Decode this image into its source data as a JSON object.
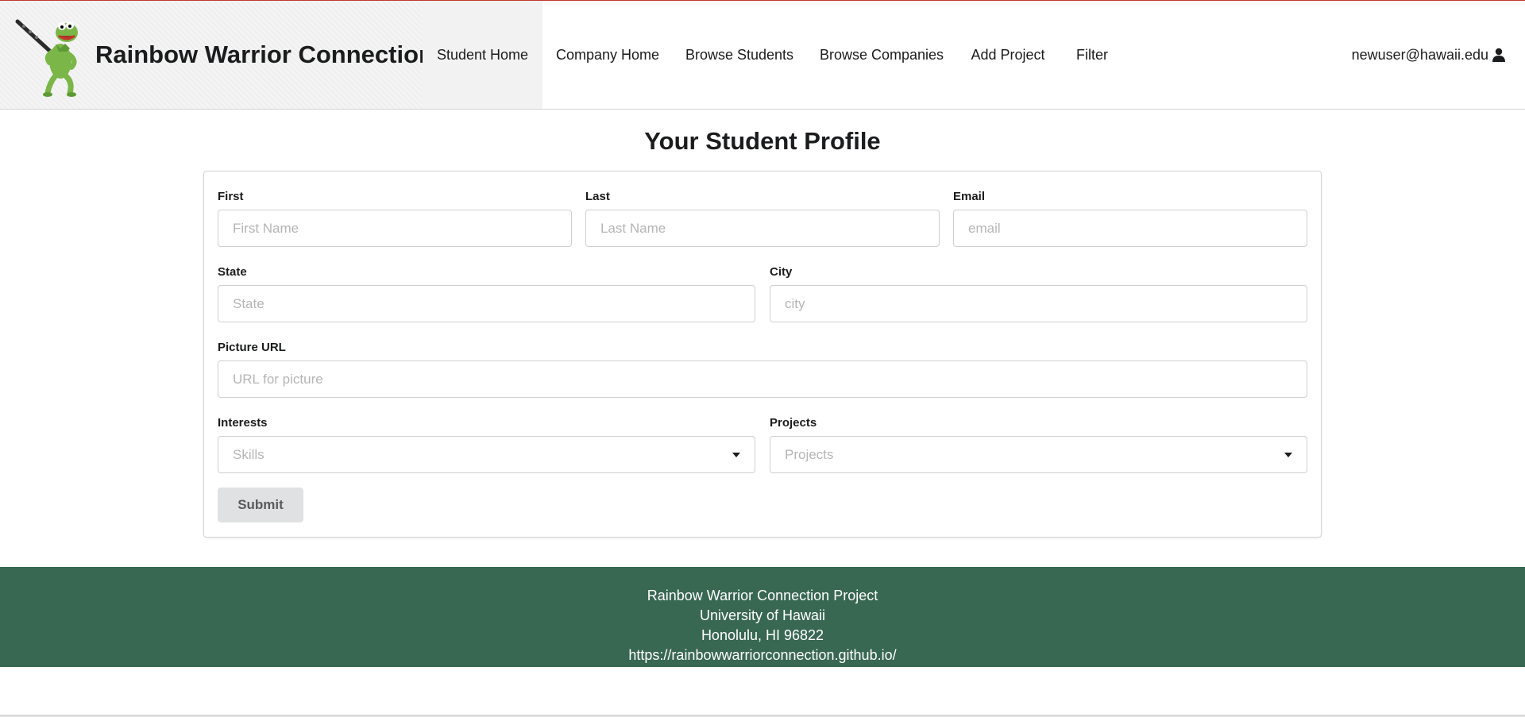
{
  "navbar": {
    "brand_title": "Rainbow Warrior Connection",
    "items": [
      {
        "label": "Student Home",
        "active": true
      },
      {
        "label": "Company Home",
        "active": false
      },
      {
        "label": "Browse Students",
        "active": false
      },
      {
        "label": "Browse Companies",
        "active": false
      },
      {
        "label": "Add Project",
        "active": false
      },
      {
        "label": "Filter",
        "active": false
      }
    ],
    "user_email": "newuser@hawaii.edu",
    "user_icon": "user-icon"
  },
  "page": {
    "title": "Your Student Profile"
  },
  "form": {
    "first": {
      "label": "First",
      "placeholder": "First Name",
      "value": ""
    },
    "last": {
      "label": "Last",
      "placeholder": "Last Name",
      "value": ""
    },
    "email": {
      "label": "Email",
      "placeholder": "email",
      "value": ""
    },
    "state": {
      "label": "State",
      "placeholder": "State",
      "value": ""
    },
    "city": {
      "label": "City",
      "placeholder": "city",
      "value": ""
    },
    "picture": {
      "label": "Picture URL",
      "placeholder": "URL for picture",
      "value": ""
    },
    "interests": {
      "label": "Interests",
      "placeholder": "Skills"
    },
    "projects": {
      "label": "Projects",
      "placeholder": "Projects"
    },
    "submit_label": "Submit"
  },
  "footer": {
    "lines": [
      "Rainbow Warrior Connection Project",
      "University of Hawaii",
      "Honolulu, HI 96822",
      "https://rainbowwarriorconnection.github.io/"
    ],
    "background": "#386752"
  },
  "colors": {
    "footer_bg": "#386752",
    "active_nav_bg": "#f2f2f2",
    "button_bg": "#e0e1e2"
  }
}
